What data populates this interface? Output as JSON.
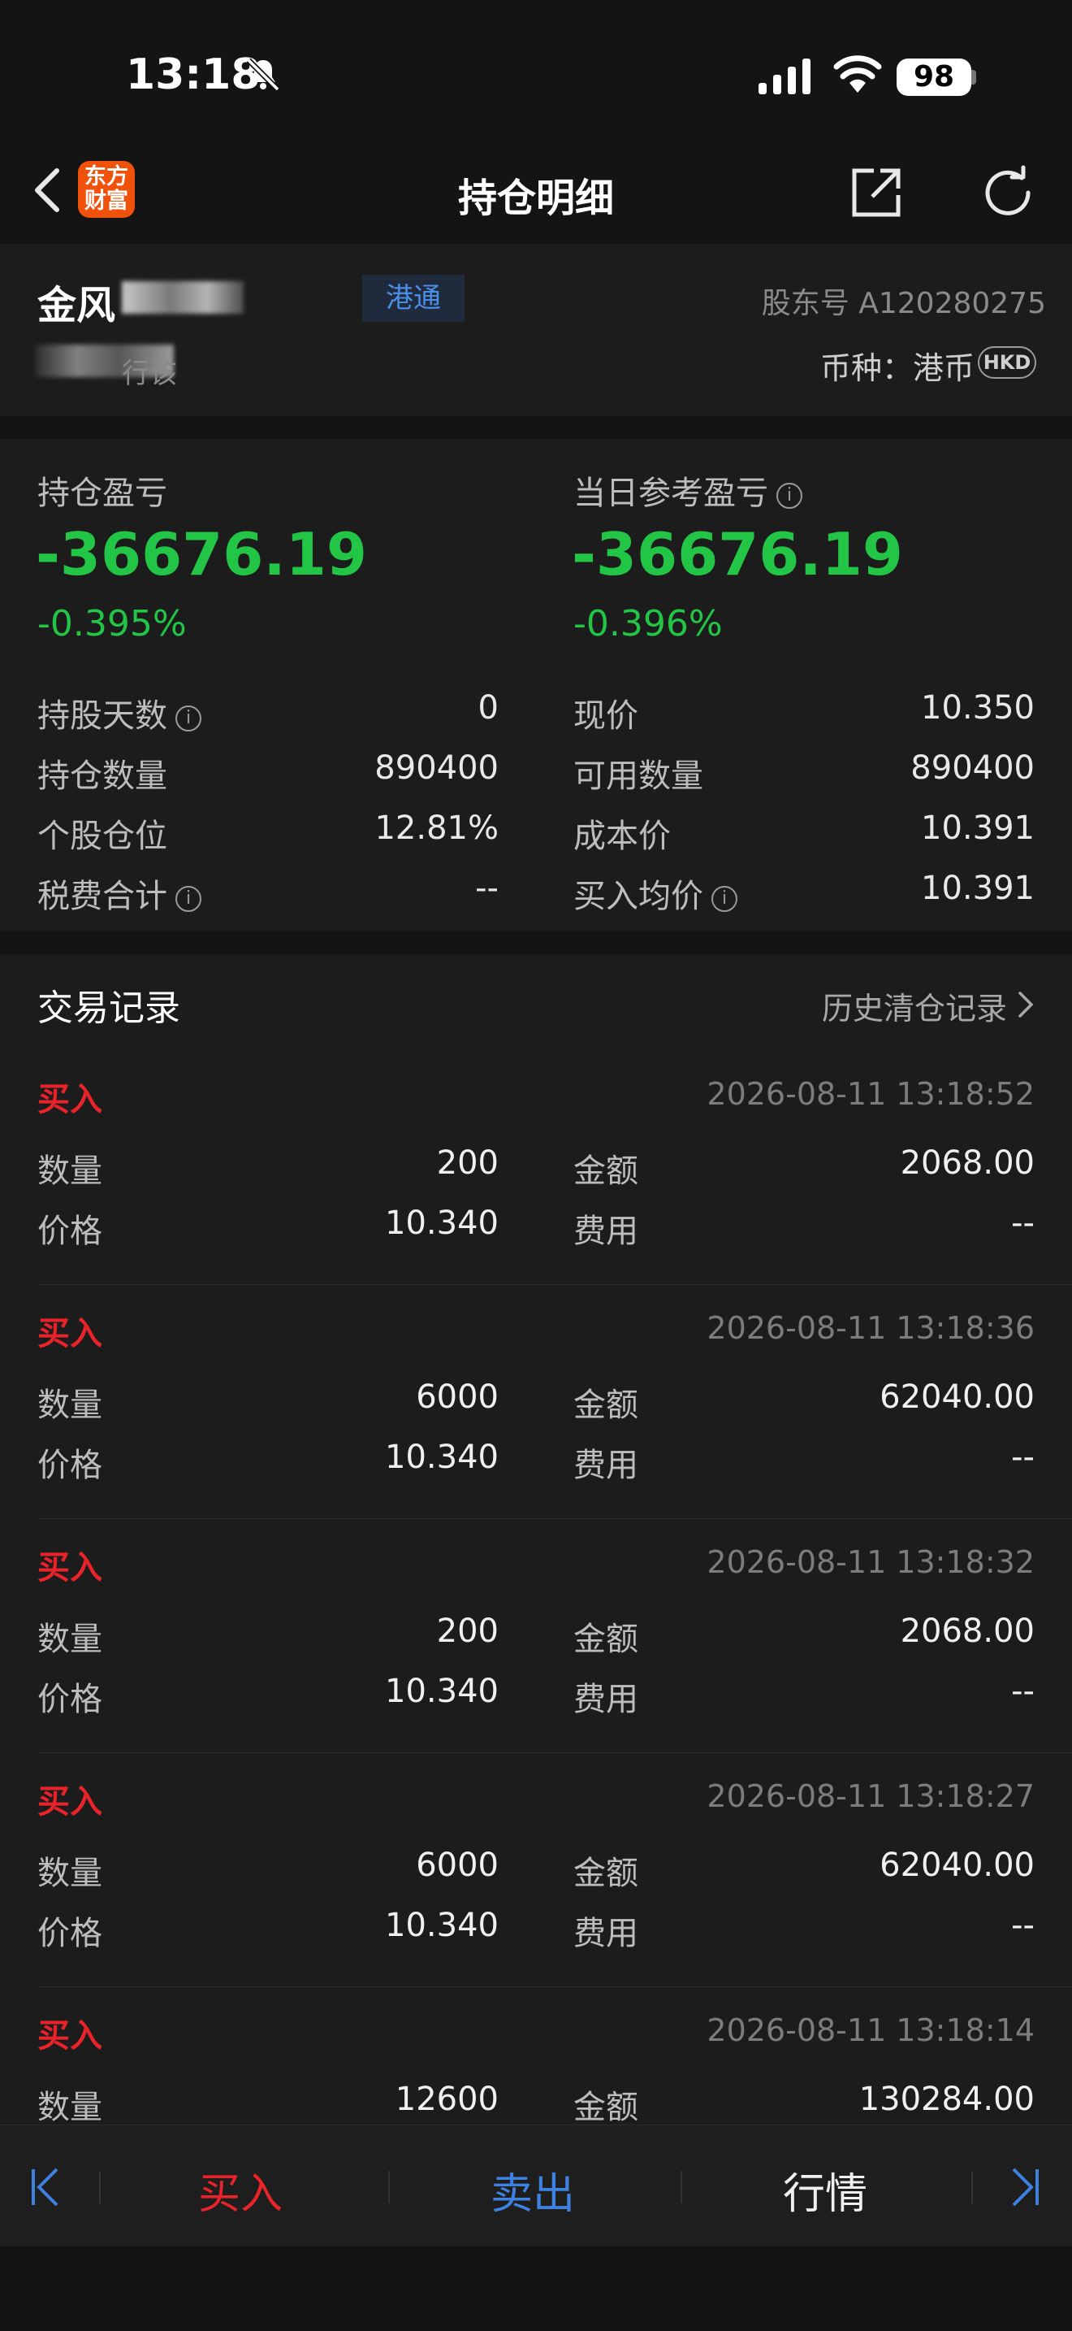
{
  "status_bar": {
    "time": "13:18",
    "battery": "98",
    "icons": [
      "bell-slash-icon",
      "cellular-signal-icon",
      "wifi-icon",
      "battery-icon"
    ]
  },
  "nav": {
    "logo_line1": "东方",
    "logo_line2": "财富",
    "title": "持仓明细",
    "icons": [
      "back-chevron-icon",
      "share-icon",
      "refresh-icon"
    ]
  },
  "stock": {
    "name": "金风",
    "tag": "港通",
    "suffix": "行该",
    "holder_id": "股东号 A120280275",
    "currency_label": "币种：港币",
    "currency_code": "HKD"
  },
  "summary": {
    "position_pl_label": "持仓盈亏",
    "position_pl_value": "-36676.19",
    "position_pl_pct": "-0.395%",
    "daily_pl_label": "当日参考盈亏",
    "daily_pl_value": "-36676.19",
    "daily_pl_pct": "-0.396%",
    "left_rows": [
      {
        "label": "持股天数",
        "value": "0",
        "info": true
      },
      {
        "label": "持仓数量",
        "value": "890400",
        "info": false
      },
      {
        "label": "个股仓位",
        "value": "12.81%",
        "info": false
      },
      {
        "label": "税费合计",
        "value": "--",
        "info": true
      }
    ],
    "right_rows": [
      {
        "label": "现价",
        "value": "10.350",
        "info": false
      },
      {
        "label": "可用数量",
        "value": "890400",
        "info": false
      },
      {
        "label": "成本价",
        "value": "10.391",
        "info": false
      },
      {
        "label": "买入均价",
        "value": "10.391",
        "info": true
      }
    ],
    "info_glyph": "i"
  },
  "records": {
    "title": "交易记录",
    "history_link": "历史清仓记录",
    "labels": {
      "qty": "数量",
      "amount": "金额",
      "price": "价格",
      "fee": "费用"
    },
    "items": [
      {
        "type": "买入",
        "time": "2026-08-11 13:18:52",
        "qty": "200",
        "amount": "2068.00",
        "price": "10.340",
        "fee": "--"
      },
      {
        "type": "买入",
        "time": "2026-08-11 13:18:36",
        "qty": "6000",
        "amount": "62040.00",
        "price": "10.340",
        "fee": "--"
      },
      {
        "type": "买入",
        "time": "2026-08-11 13:18:32",
        "qty": "200",
        "amount": "2068.00",
        "price": "10.340",
        "fee": "--"
      },
      {
        "type": "买入",
        "time": "2026-08-11 13:18:27",
        "qty": "6000",
        "amount": "62040.00",
        "price": "10.340",
        "fee": "--"
      },
      {
        "type": "买入",
        "time": "2026-08-11 13:18:14",
        "qty": "12600",
        "amount": "130284.00",
        "price": "",
        "fee": ""
      }
    ]
  },
  "bottom_bar": {
    "buy": "买入",
    "sell": "卖出",
    "quote": "行情"
  },
  "colors": {
    "loss_green": "#22c545",
    "buy_red": "#e8232a",
    "sell_blue": "#3d82e0",
    "brand_orange": "#f0520c"
  }
}
